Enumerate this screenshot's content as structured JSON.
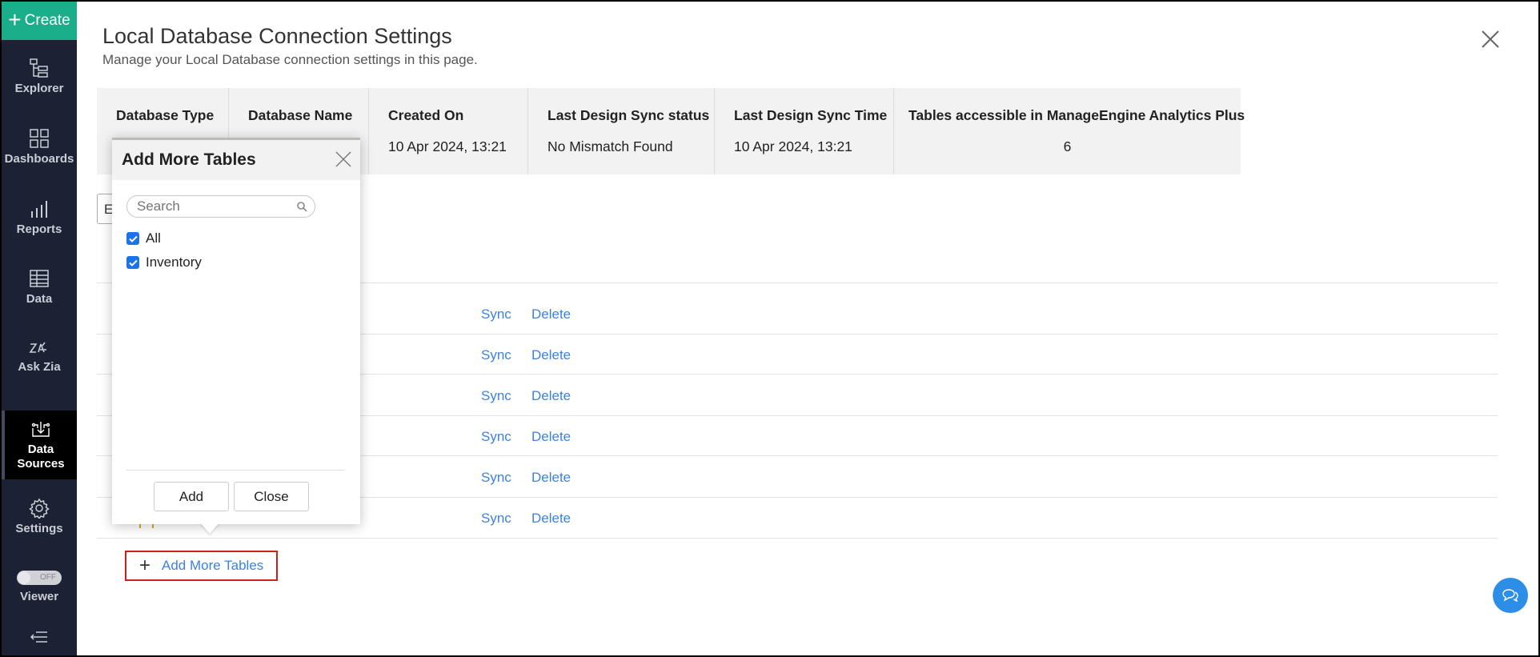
{
  "sidebar": {
    "create_label": "Create",
    "items": [
      {
        "label": "Explorer",
        "icon": "explorer-icon"
      },
      {
        "label": "Dashboards",
        "icon": "dashboards-icon"
      },
      {
        "label": "Reports",
        "icon": "reports-icon"
      },
      {
        "label": "Data",
        "icon": "data-icon"
      },
      {
        "label": "Ask Zia",
        "icon": "zia-icon"
      },
      {
        "label": "Data Sources",
        "icon": "data-sources-icon",
        "active": true
      },
      {
        "label": "Settings",
        "icon": "gear-icon"
      }
    ],
    "viewer_label": "Viewer",
    "viewer_toggle": "OFF"
  },
  "header": {
    "title": "Local Database Connection Settings",
    "subtitle": "Manage your Local Database connection settings in this page."
  },
  "info": [
    {
      "h": "Database Type",
      "v": ""
    },
    {
      "h": "Database Name",
      "v": ""
    },
    {
      "h": "Created On",
      "v": "10 Apr 2024, 13:21"
    },
    {
      "h": "Last Design Sync status",
      "v": "No Mismatch Found"
    },
    {
      "h": "Last Design Sync Time",
      "v": "10 Apr 2024, 13:21"
    },
    {
      "h": "Tables accessible in ManageEngine Analytics Plus",
      "v": "6"
    }
  ],
  "edit_button_partial": "E",
  "rows": [
    {
      "sync": "Sync",
      "delete": "Delete"
    },
    {
      "sync": "Sync",
      "delete": "Delete"
    },
    {
      "sync": "Sync",
      "delete": "Delete"
    },
    {
      "sync": "Sync",
      "delete": "Delete"
    },
    {
      "sync": "Sync",
      "delete": "Delete"
    },
    {
      "sync": "Sync",
      "delete": "Delete"
    }
  ],
  "add_more_link": "Add More Tables",
  "popup": {
    "title": "Add More Tables",
    "search_placeholder": "Search",
    "options": [
      {
        "label": "All",
        "checked": true
      },
      {
        "label": "Inventory",
        "checked": true
      }
    ],
    "add_label": "Add",
    "close_label": "Close"
  },
  "colors": {
    "accent": "#1aae8a",
    "link": "#3b82e0",
    "highlight": "#cc1f1f",
    "sidebar": "#1c2133"
  }
}
